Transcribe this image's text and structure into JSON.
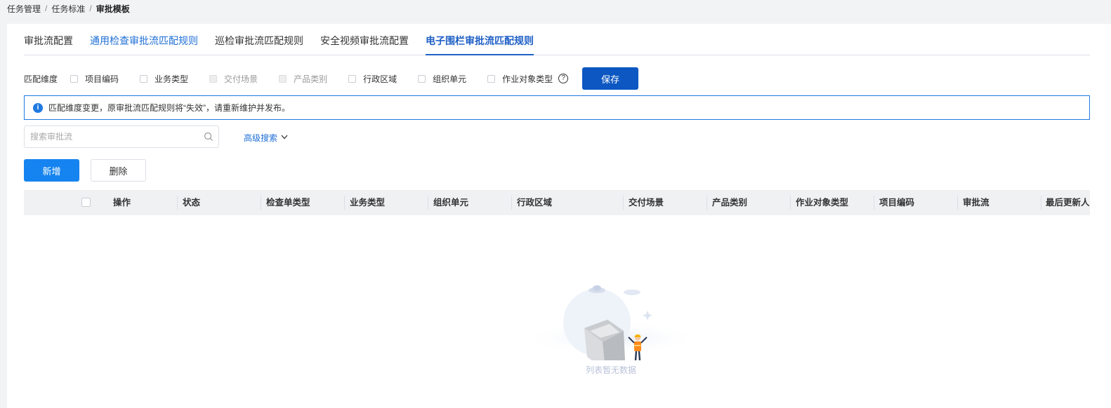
{
  "breadcrumb": [
    "任务管理",
    "任务标准",
    "审批模板"
  ],
  "tabs": [
    {
      "label": "审批流配置",
      "style": "normal"
    },
    {
      "label": "通用检查审批流匹配规则",
      "style": "blue"
    },
    {
      "label": "巡检审批流匹配规则",
      "style": "normal"
    },
    {
      "label": "安全视频审批流配置",
      "style": "normal"
    },
    {
      "label": "电子围栏审批流匹配规则",
      "style": "active"
    }
  ],
  "dimensions": {
    "label": "匹配维度",
    "options": [
      {
        "label": "项目编码",
        "disabled": false
      },
      {
        "label": "业务类型",
        "disabled": false
      },
      {
        "label": "交付场景",
        "disabled": true
      },
      {
        "label": "产品类别",
        "disabled": true
      },
      {
        "label": "行政区域",
        "disabled": false
      },
      {
        "label": "组织单元",
        "disabled": false
      },
      {
        "label": "作业对象类型",
        "disabled": false
      }
    ],
    "help_icon": "?",
    "save_label": "保存"
  },
  "alert": {
    "icon": "i",
    "text": "匹配维度变更，原审批流匹配规则将“失效”，请重新维护并发布。"
  },
  "search": {
    "placeholder": "搜索审批流",
    "advanced_label": "高级搜索"
  },
  "actions": {
    "add_label": "新增",
    "delete_label": "删除"
  },
  "table": {
    "columns": [
      "操作",
      "状态",
      "检查单类型",
      "业务类型",
      "组织单元",
      "行政区域",
      "交付场景",
      "产品类别",
      "作业对象类型",
      "项目编码",
      "审批流",
      "最后更新人"
    ],
    "empty_text": "列表暂无数据"
  },
  "colors": {
    "primary": "#0c57c2",
    "accent": "#1684f0",
    "tab_active": "#1f5fc6",
    "alert_border": "#1f7ae0"
  }
}
